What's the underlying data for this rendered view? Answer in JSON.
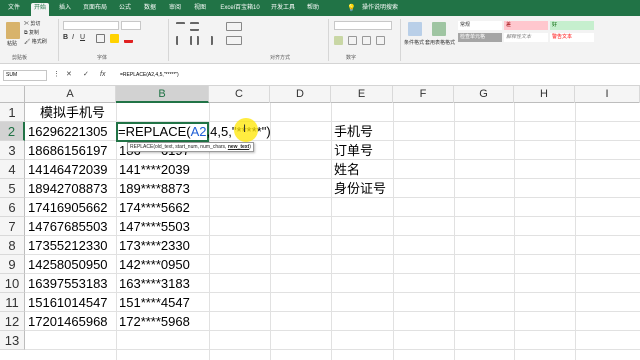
{
  "colors": {
    "brand": "#217346",
    "ref_blue": "#1f5fd6",
    "cursor_highlight": "#ffe600"
  },
  "tabs": [
    {
      "label": "文件",
      "active": false
    },
    {
      "label": "开始",
      "active": true
    },
    {
      "label": "插入",
      "active": false
    },
    {
      "label": "页面布局",
      "active": false
    },
    {
      "label": "公式",
      "active": false
    },
    {
      "label": "数据",
      "active": false
    },
    {
      "label": "审阅",
      "active": false
    },
    {
      "label": "视图",
      "active": false
    },
    {
      "label": "Excel百宝箱10",
      "active": false
    },
    {
      "label": "开发工具",
      "active": false
    },
    {
      "label": "帮助",
      "active": false
    }
  ],
  "tell_me": "操作说明搜索",
  "ribbon": {
    "clipboard": {
      "paste": "粘贴",
      "cut": "剪切",
      "copy": "复制",
      "painter": "格式刷",
      "label": "剪贴板"
    },
    "font": {
      "label": "字体"
    },
    "alignment": {
      "label": "对齐方式"
    },
    "number": {
      "label": "数字"
    },
    "styles": {
      "cond_format": "条件格式",
      "table_format": "套用表格格式",
      "normal": "常规",
      "bad": "差",
      "good": "好",
      "explain": "解释性文本",
      "check": "检查单元格",
      "warning": "警告文本"
    }
  },
  "formula_bar": {
    "name_box": "SUM",
    "cancel": "✕",
    "enter": "✓",
    "fx": "fx",
    "content": "=REPLACE(A2,4,5,\"*****\")"
  },
  "columns": [
    "A",
    "B",
    "C",
    "D",
    "E",
    "F",
    "G",
    "H",
    "I"
  ],
  "rows": [
    "1",
    "2",
    "3",
    "4",
    "5",
    "6",
    "7",
    "8",
    "9",
    "10",
    "11",
    "12",
    "13"
  ],
  "cells": {
    "A1": "模拟手机号",
    "A2": "16296221305",
    "A3": "18686156197",
    "A4": "14146472039",
    "A5": "18942708873",
    "A6": "17416905662",
    "A7": "14767685503",
    "A8": "17355212330",
    "A9": "14258050950",
    "A10": "16397553183",
    "A11": "15161014547",
    "A12": "17201465968",
    "B3": "186****6197",
    "B4": "141****2039",
    "B5": "189****8873",
    "B6": "174****5662",
    "B7": "147****5503",
    "B8": "173****2330",
    "B9": "142****0950",
    "B10": "163****3183",
    "B11": "151****4547",
    "B12": "172****5968",
    "E2": "手机号",
    "E3": "订单号",
    "E4": "姓名",
    "E5": "身份证号"
  },
  "editor": {
    "prefix": "=REPLACE(",
    "ref": "A2",
    "suffix": ",4,5,\"*****\")"
  },
  "tooltip": {
    "text": "REPLACE(old_text, start_num, num_chars, ",
    "current": "new_text",
    ")": ")"
  }
}
